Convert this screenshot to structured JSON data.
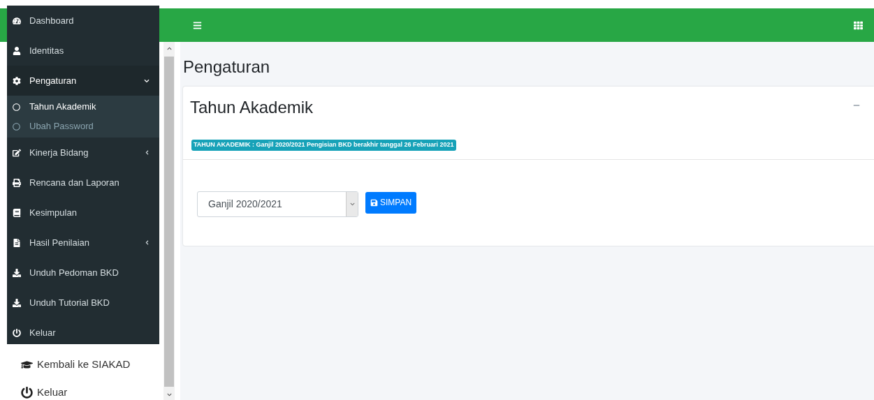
{
  "sidebar": {
    "items": [
      {
        "label": "Dashboard"
      },
      {
        "label": "Identitas"
      },
      {
        "label": "Pengaturan",
        "expanded": true,
        "selected": true,
        "children": [
          {
            "label": "Tahun Akademik",
            "selected": true
          },
          {
            "label": "Ubah Password",
            "selected": false
          }
        ]
      },
      {
        "label": "Kinerja Bidang",
        "expanded": false,
        "selected": false
      },
      {
        "label": "Rencana dan Laporan"
      },
      {
        "label": "Kesimpulan"
      },
      {
        "label": "Hasil Penilaian",
        "expanded": false,
        "selected": false
      },
      {
        "label": "Unduh Pedoman BKD"
      },
      {
        "label": "Unduh Tutorial BKD"
      },
      {
        "label": "Keluar"
      }
    ]
  },
  "under_links": [
    {
      "label": "Kembali ke SIAKAD"
    },
    {
      "label": "Keluar"
    }
  ],
  "page_title": "Pengaturan",
  "card": {
    "title": "Tahun Akademik",
    "badge": "TAHUN AKADEMIK : Ganjil 2020/2021 Pengisian BKD berakhir tanggal 26 Februari 2021",
    "select": {
      "value": "Ganjil 2020/2021"
    },
    "button": "SIMPAN"
  }
}
